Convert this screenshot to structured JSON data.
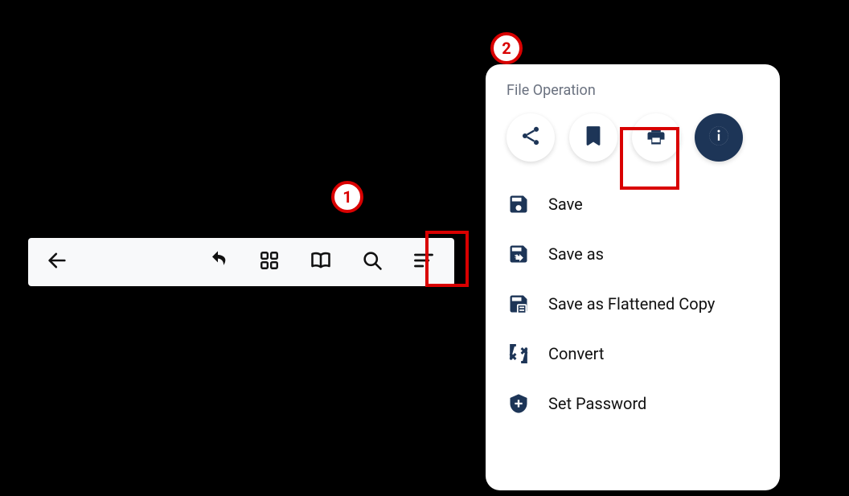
{
  "callouts": {
    "one": "1",
    "two": "2"
  },
  "panel": {
    "title": "File Operation",
    "actions": {
      "share": "share",
      "bookmark": "bookmark",
      "print": "print",
      "info": "info"
    },
    "menu": {
      "save": "Save",
      "save_as": "Save as",
      "save_flat": "Save as Flattened Copy",
      "convert": "Convert",
      "set_password": "Set Password"
    }
  }
}
